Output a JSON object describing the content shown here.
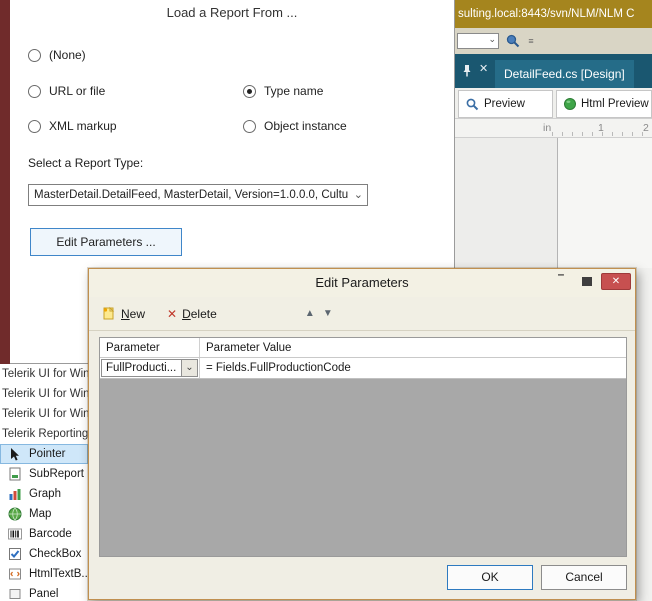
{
  "icons": {
    "close": "✕",
    "doc_close": "✕",
    "dropdown": "⌄",
    "minimize": "–",
    "up_arrow": "▲",
    "down_arrow": "▼",
    "delete_glyph": "✕",
    "overflow": "≡"
  },
  "background": {
    "address": "sulting.local:8443/svn/NLM/NLM C",
    "doc_tab": "DetailFeed.cs [Design]",
    "tabs": {
      "preview": "Preview",
      "html_preview": "Html Preview"
    },
    "ruler": {
      "unit": "in",
      "marks": [
        "1",
        "2"
      ]
    }
  },
  "toolbox": {
    "groups": [
      "Telerik UI for Win...",
      "Telerik UI for Win...",
      "Telerik UI for Win...",
      "Telerik Reporting"
    ],
    "items": [
      {
        "label": "Pointer",
        "selected": true
      },
      {
        "label": "SubReport",
        "selected": false
      },
      {
        "label": "Graph",
        "selected": false
      },
      {
        "label": "Map",
        "selected": false
      },
      {
        "label": "Barcode",
        "selected": false
      },
      {
        "label": "CheckBox",
        "selected": false
      },
      {
        "label": "HtmlTextB...",
        "selected": false
      },
      {
        "label": "Panel",
        "selected": false
      }
    ]
  },
  "load_dialog": {
    "title": "Load a Report From ...",
    "options": [
      {
        "label": "(None)",
        "selected": false
      },
      {
        "label": "URL or file",
        "selected": false
      },
      {
        "label": "Type name",
        "selected": true
      },
      {
        "label": "XML markup",
        "selected": false
      },
      {
        "label": "Object instance",
        "selected": false
      }
    ],
    "select_type_label": "Select a Report Type:",
    "report_type_value": "MasterDetail.DetailFeed, MasterDetail, Version=1.0.0.0, Cultu",
    "edit_parameters_button": "Edit Parameters ..."
  },
  "edit_dialog": {
    "title": "Edit Parameters",
    "toolbar": {
      "new_label": "New",
      "delete_label": "Delete"
    },
    "grid": {
      "columns": [
        "Parameter",
        "Parameter Value"
      ],
      "rows": [
        {
          "parameter": "FullProducti...",
          "value": "= Fields.FullProductionCode"
        }
      ]
    },
    "ok_button": "OK",
    "cancel_button": "Cancel"
  }
}
